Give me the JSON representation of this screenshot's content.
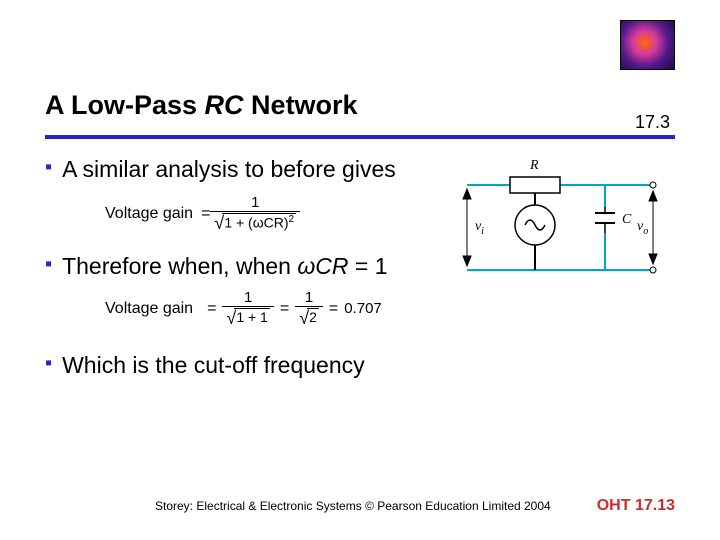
{
  "header": {
    "title_prefix": "A Low-Pass ",
    "title_ital": "RC",
    "title_suffix": " Network",
    "section": "17.3"
  },
  "bullets": {
    "b1": "A similar analysis to before gives",
    "b2_pre": "Therefore when, when ",
    "b2_expr": "ωCR",
    "b2_post": " = 1",
    "b3": "Which is the cut-off frequency"
  },
  "equations": {
    "label": "Voltage gain",
    "eq1_num": "1",
    "eq1_under": "1 + (ωCR)",
    "eq1_exp": "2",
    "eq2_mid_num": "1",
    "eq2_mid_under": "1 + 1",
    "eq2_r_num": "1",
    "eq2_r_under": "2",
    "eq2_val": "0.707",
    "equals": "="
  },
  "circuit": {
    "R": "R",
    "C": "C",
    "vi": "v",
    "vi_sub": "i",
    "vo": "v",
    "vo_sub": "o"
  },
  "footer": {
    "copyright": "Storey: Electrical & Electronic Systems © Pearson Education Limited 2004",
    "slide": "OHT 17.13"
  }
}
